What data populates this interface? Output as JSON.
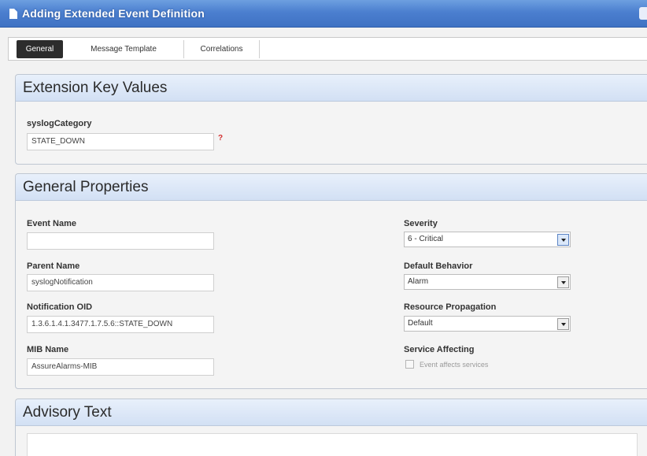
{
  "window": {
    "title": "Adding Extended Event Definition"
  },
  "tabs": [
    {
      "label": "General",
      "active": true
    },
    {
      "label": "Message Template",
      "active": false
    },
    {
      "label": "Correlations",
      "active": false
    }
  ],
  "extension_key_values": {
    "heading": "Extension Key Values",
    "syslog_category_label": "syslogCategory",
    "syslog_category_value": "STATE_DOWN",
    "required_marker": "?"
  },
  "general_properties": {
    "heading": "General Properties",
    "event_name_label": "Event Name",
    "event_name_value": "",
    "parent_name_label": "Parent Name",
    "parent_name_value": "syslogNotification",
    "notification_oid_label": "Notification OID",
    "notification_oid_value": "1.3.6.1.4.1.3477.1.7.5.6::STATE_DOWN",
    "mib_name_label": "MIB Name",
    "mib_name_value": "AssureAlarms-MIB",
    "severity_label": "Severity",
    "severity_value": "6 - Critical",
    "default_behavior_label": "Default Behavior",
    "default_behavior_value": "Alarm",
    "resource_propagation_label": "Resource Propagation",
    "resource_propagation_value": "Default",
    "service_affecting_label": "Service Affecting",
    "service_affecting_checkbox_label": "Event affects services",
    "service_affecting_checked": false
  },
  "advisory_text": {
    "heading": "Advisory Text",
    "value": ""
  },
  "icons": {
    "title": "document-icon",
    "dropdown": "chevron-down-icon",
    "close": "close-icon"
  },
  "colors": {
    "titlebar": "#4b7fcf",
    "panel_header": "#d2e0f4",
    "active_tab": "#2c2c2c",
    "required": "#d32f2f"
  }
}
